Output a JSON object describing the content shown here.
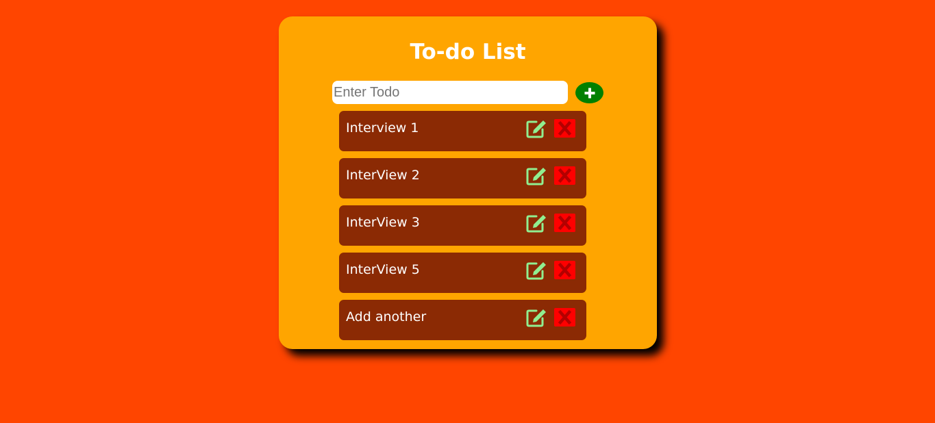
{
  "app": {
    "title": "To-do List"
  },
  "input": {
    "placeholder": "Enter Todo",
    "value": ""
  },
  "add_button": {
    "icon": "plus-icon"
  },
  "todos": [
    {
      "text": "Interview 1"
    },
    {
      "text": "InterView 2"
    },
    {
      "text": "InterView 3"
    },
    {
      "text": "InterView 5"
    },
    {
      "text": "Add another"
    }
  ],
  "item_actions": {
    "edit_icon": "edit-icon",
    "delete_icon": "close-icon"
  },
  "colors": {
    "page_background": "#ff4500",
    "card_background": "#ffa500",
    "item_background": "#8b2a04",
    "add_button": "#008000",
    "edit_icon": "#90ee90",
    "delete_button": "#ff0000",
    "delete_icon": "#b30000",
    "text": "#ffffff"
  }
}
